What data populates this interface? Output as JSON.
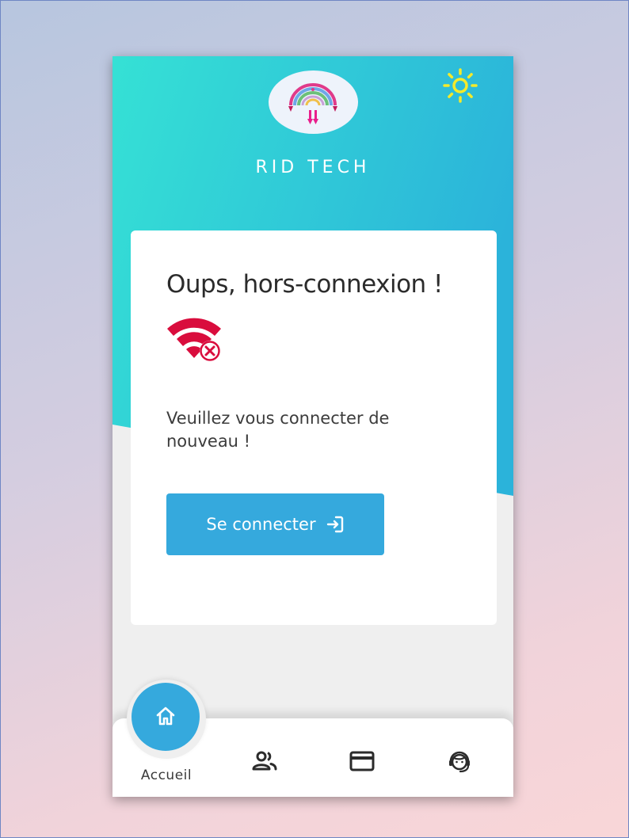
{
  "app": {
    "brand_name": "RID TECH",
    "accent_color": "#35a9dd",
    "gradient_colors": [
      "#35e1d5",
      "#2bb3da"
    ]
  },
  "offline_card": {
    "title": "Oups, hors-connexion !",
    "message": "Veuillez vous connecter de nouveau !",
    "icon": "wifi-off-icon",
    "icon_color": "#d90d3d"
  },
  "connect_button": {
    "label": "Se connecter",
    "icon": "login-icon"
  },
  "theme_toggle": {
    "icon": "sun-icon",
    "color": "#f4ea2a"
  },
  "bottom_nav": {
    "items": [
      {
        "label": "Accueil",
        "icon": "home-icon",
        "active": true
      },
      {
        "label": "",
        "icon": "users-icon",
        "active": false
      },
      {
        "label": "",
        "icon": "credit-card-icon",
        "active": false
      },
      {
        "label": "",
        "icon": "support-agent-icon",
        "active": false
      }
    ]
  }
}
